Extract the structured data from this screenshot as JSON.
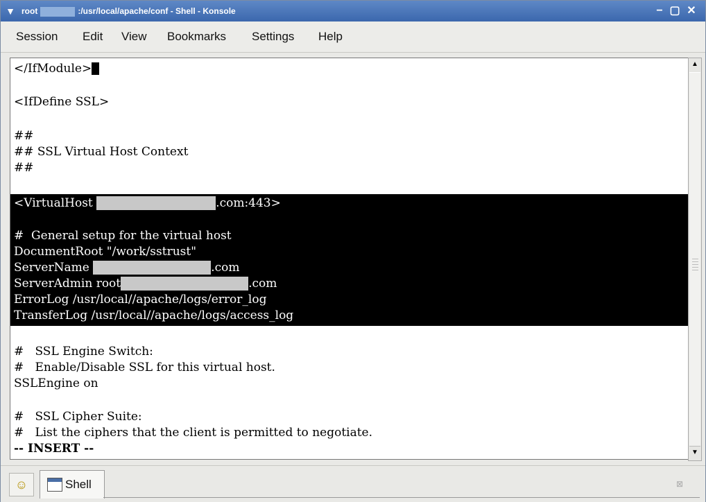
{
  "window": {
    "title_prefix": "root",
    "title_rest": ":/usr/local/apache/conf - Shell - Konsole",
    "menu_icon": "chevron-down-icon",
    "buttons": {
      "minimize": "−",
      "maximize": "▢",
      "close": "✕"
    }
  },
  "menubar": {
    "items": [
      "Session",
      "Edit",
      "View",
      "Bookmarks",
      "Settings",
      "Help"
    ]
  },
  "terminal": {
    "l0": "</IfModule>",
    "l2": "<IfDefine SSL>",
    "l4": "##",
    "l5": "## SSL Virtual Host Context",
    "l6": "##",
    "l8a": "<VirtualHost ",
    "l8b": ".com:443>",
    "l10": "#  General setup for the virtual host",
    "l11": "DocumentRoot \"/work/sstrust\"",
    "l12a": "ServerName ",
    "l12b": ".com",
    "l13a": "ServerAdmin root",
    "l13b": ".com",
    "l14": "ErrorLog /usr/local//apache/logs/error_log",
    "l15": "TransferLog /usr/local//apache/logs/access_log",
    "l17": "#   SSL Engine Switch:",
    "l18": "#   Enable/Disable SSL for this virtual host.",
    "l19": "SSLEngine on",
    "l21": "#   SSL Cipher Suite:",
    "l22": "#   List the ciphers that the client is permitted to negotiate.",
    "l23": "-- INSERT --"
  },
  "tabbar": {
    "new_session_icon": "new-session-icon",
    "tab_label": "Shell",
    "close_icon": "close-tab-icon",
    "close_glyph": "⊠"
  }
}
